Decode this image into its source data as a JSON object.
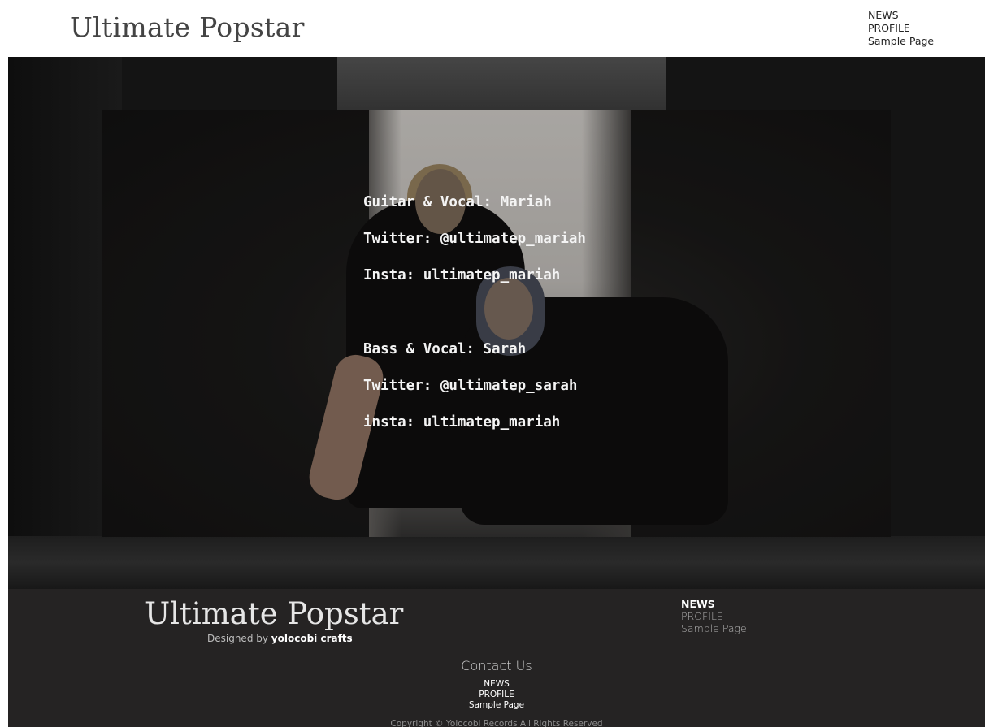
{
  "header": {
    "site_title": "Ultimate Popstar",
    "nav": [
      "NEWS",
      "PROFILE",
      "Sample Page"
    ]
  },
  "hero": {
    "members": [
      {
        "role_line": "Guitar & Vocal: Mariah",
        "twitter_line": "Twitter: @ultimatep_mariah",
        "insta_line": "Insta: ultimatep_mariah"
      },
      {
        "role_line": "Bass & Vocal: Sarah",
        "twitter_line": "Twitter: @ultimatep_sarah",
        "insta_line": "insta: ultimatep_mariah"
      }
    ]
  },
  "footer": {
    "site_title": "Ultimate Popstar",
    "designed_prefix": "Designed by",
    "designed_by": "yolocobi crafts",
    "nav": [
      "NEWS",
      "PROFILE",
      "Sample Page"
    ],
    "contact_label": "Contact Us",
    "bottom_nav": [
      "NEWS",
      "PROFILE",
      "Sample Page"
    ],
    "copyright": "Copyright © Yolocobi Records All Rights Reserved"
  }
}
